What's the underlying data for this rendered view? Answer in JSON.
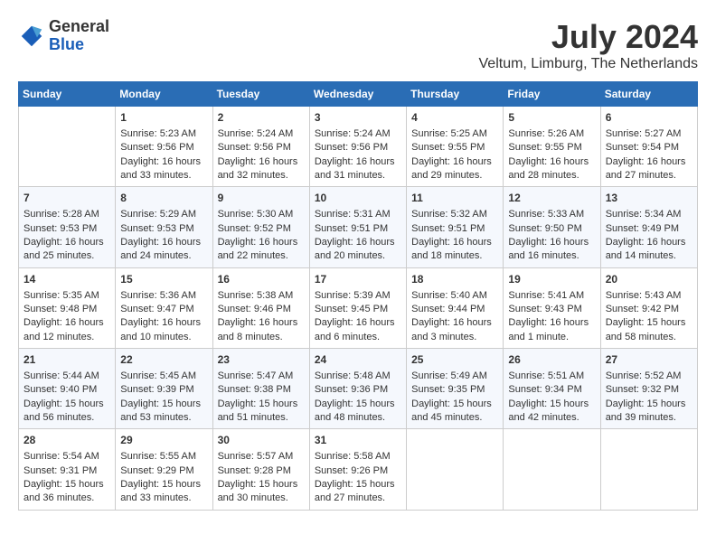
{
  "header": {
    "logo_general": "General",
    "logo_blue": "Blue",
    "month_year": "July 2024",
    "location": "Veltum, Limburg, The Netherlands"
  },
  "columns": [
    "Sunday",
    "Monday",
    "Tuesday",
    "Wednesday",
    "Thursday",
    "Friday",
    "Saturday"
  ],
  "weeks": [
    [
      {
        "day": "",
        "empty": true
      },
      {
        "day": "1",
        "sunrise": "5:23 AM",
        "sunset": "9:56 PM",
        "daylight": "16 hours and 33 minutes."
      },
      {
        "day": "2",
        "sunrise": "5:24 AM",
        "sunset": "9:56 PM",
        "daylight": "16 hours and 32 minutes."
      },
      {
        "day": "3",
        "sunrise": "5:24 AM",
        "sunset": "9:56 PM",
        "daylight": "16 hours and 31 minutes."
      },
      {
        "day": "4",
        "sunrise": "5:25 AM",
        "sunset": "9:55 PM",
        "daylight": "16 hours and 29 minutes."
      },
      {
        "day": "5",
        "sunrise": "5:26 AM",
        "sunset": "9:55 PM",
        "daylight": "16 hours and 28 minutes."
      },
      {
        "day": "6",
        "sunrise": "5:27 AM",
        "sunset": "9:54 PM",
        "daylight": "16 hours and 27 minutes."
      }
    ],
    [
      {
        "day": "7",
        "sunrise": "5:28 AM",
        "sunset": "9:53 PM",
        "daylight": "16 hours and 25 minutes."
      },
      {
        "day": "8",
        "sunrise": "5:29 AM",
        "sunset": "9:53 PM",
        "daylight": "16 hours and 24 minutes."
      },
      {
        "day": "9",
        "sunrise": "5:30 AM",
        "sunset": "9:52 PM",
        "daylight": "16 hours and 22 minutes."
      },
      {
        "day": "10",
        "sunrise": "5:31 AM",
        "sunset": "9:51 PM",
        "daylight": "16 hours and 20 minutes."
      },
      {
        "day": "11",
        "sunrise": "5:32 AM",
        "sunset": "9:51 PM",
        "daylight": "16 hours and 18 minutes."
      },
      {
        "day": "12",
        "sunrise": "5:33 AM",
        "sunset": "9:50 PM",
        "daylight": "16 hours and 16 minutes."
      },
      {
        "day": "13",
        "sunrise": "5:34 AM",
        "sunset": "9:49 PM",
        "daylight": "16 hours and 14 minutes."
      }
    ],
    [
      {
        "day": "14",
        "sunrise": "5:35 AM",
        "sunset": "9:48 PM",
        "daylight": "16 hours and 12 minutes."
      },
      {
        "day": "15",
        "sunrise": "5:36 AM",
        "sunset": "9:47 PM",
        "daylight": "16 hours and 10 minutes."
      },
      {
        "day": "16",
        "sunrise": "5:38 AM",
        "sunset": "9:46 PM",
        "daylight": "16 hours and 8 minutes."
      },
      {
        "day": "17",
        "sunrise": "5:39 AM",
        "sunset": "9:45 PM",
        "daylight": "16 hours and 6 minutes."
      },
      {
        "day": "18",
        "sunrise": "5:40 AM",
        "sunset": "9:44 PM",
        "daylight": "16 hours and 3 minutes."
      },
      {
        "day": "19",
        "sunrise": "5:41 AM",
        "sunset": "9:43 PM",
        "daylight": "16 hours and 1 minute."
      },
      {
        "day": "20",
        "sunrise": "5:43 AM",
        "sunset": "9:42 PM",
        "daylight": "15 hours and 58 minutes."
      }
    ],
    [
      {
        "day": "21",
        "sunrise": "5:44 AM",
        "sunset": "9:40 PM",
        "daylight": "15 hours and 56 minutes."
      },
      {
        "day": "22",
        "sunrise": "5:45 AM",
        "sunset": "9:39 PM",
        "daylight": "15 hours and 53 minutes."
      },
      {
        "day": "23",
        "sunrise": "5:47 AM",
        "sunset": "9:38 PM",
        "daylight": "15 hours and 51 minutes."
      },
      {
        "day": "24",
        "sunrise": "5:48 AM",
        "sunset": "9:36 PM",
        "daylight": "15 hours and 48 minutes."
      },
      {
        "day": "25",
        "sunrise": "5:49 AM",
        "sunset": "9:35 PM",
        "daylight": "15 hours and 45 minutes."
      },
      {
        "day": "26",
        "sunrise": "5:51 AM",
        "sunset": "9:34 PM",
        "daylight": "15 hours and 42 minutes."
      },
      {
        "day": "27",
        "sunrise": "5:52 AM",
        "sunset": "9:32 PM",
        "daylight": "15 hours and 39 minutes."
      }
    ],
    [
      {
        "day": "28",
        "sunrise": "5:54 AM",
        "sunset": "9:31 PM",
        "daylight": "15 hours and 36 minutes."
      },
      {
        "day": "29",
        "sunrise": "5:55 AM",
        "sunset": "9:29 PM",
        "daylight": "15 hours and 33 minutes."
      },
      {
        "day": "30",
        "sunrise": "5:57 AM",
        "sunset": "9:28 PM",
        "daylight": "15 hours and 30 minutes."
      },
      {
        "day": "31",
        "sunrise": "5:58 AM",
        "sunset": "9:26 PM",
        "daylight": "15 hours and 27 minutes."
      },
      {
        "day": "",
        "empty": true
      },
      {
        "day": "",
        "empty": true
      },
      {
        "day": "",
        "empty": true
      }
    ]
  ]
}
